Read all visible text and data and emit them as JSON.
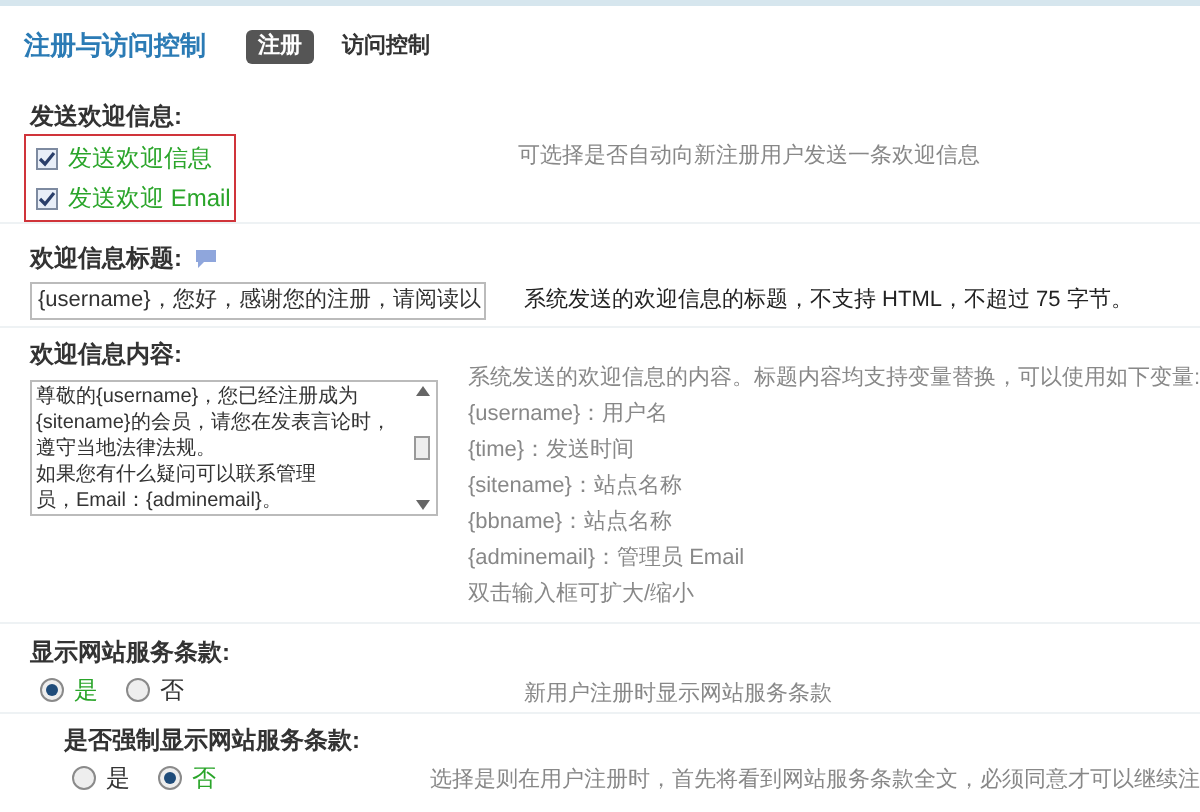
{
  "header": {
    "title": "注册与访问控制",
    "tabs": [
      {
        "label": "注册",
        "selected": true
      },
      {
        "label": "访问控制",
        "selected": false
      }
    ]
  },
  "welcome": {
    "label": "发送欢迎信息:",
    "options": [
      {
        "label": "发送欢迎信息",
        "checked": true
      },
      {
        "label": "发送欢迎 Email",
        "checked": true
      }
    ],
    "help": "可选择是否自动向新注册用户发送一条欢迎信息"
  },
  "subject": {
    "label": "欢迎信息标题:",
    "value": "{username}，您好，感谢您的注册，请阅读以",
    "help": "系统发送的欢迎信息的标题，不支持 HTML，不超过 75 字节。"
  },
  "body": {
    "label": "欢迎信息内容:",
    "lines": [
      "尊敬的{username}，您已经注册成为",
      "{sitename}的会员，请您在发表言论时，",
      "遵守当地法律法规。",
      "如果您有什么疑问可以联系管理",
      "员，Email：{adminemail}。"
    ],
    "help": [
      "系统发送的欢迎信息的内容。标题内容均支持变量替换，可以使用如下变量:",
      "{username}：用户名",
      "{time}：发送时间",
      "{sitename}：站点名称",
      "{bbname}：站点名称",
      "{adminemail}：管理员 Email",
      "双击输入框可扩大/缩小"
    ]
  },
  "terms": {
    "label": "显示网站服务条款:",
    "options": [
      {
        "label": "是",
        "selected": true
      },
      {
        "label": "否",
        "selected": false
      }
    ],
    "help": "新用户注册时显示网站服务条款"
  },
  "force_terms": {
    "label": "是否强制显示网站服务条款:",
    "options": [
      {
        "label": "是",
        "selected": false
      },
      {
        "label": "否",
        "selected": true
      }
    ],
    "help": "选择是则在用户注册时，首先将看到网站服务条款全文，必须同意才可以继续注"
  }
}
